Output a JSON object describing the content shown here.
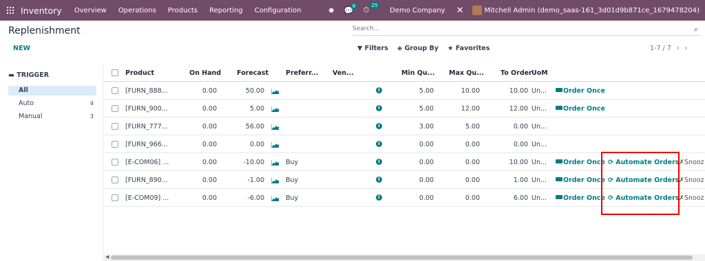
{
  "nav": {
    "brand": "Inventory",
    "menu": [
      "Overview",
      "Operations",
      "Products",
      "Reporting",
      "Configuration"
    ],
    "chat_badge": "6",
    "activity_badge": "25",
    "company": "Demo Company",
    "user": "Mitchell Admin (demo_saas-161_3d01d9b871ce_1679478204)"
  },
  "control": {
    "title": "Replenishment",
    "search_placeholder": "Search...",
    "new_label": "NEW",
    "filters_label": "Filters",
    "group_by_label": "Group By",
    "favorites_label": "Favorites",
    "pager": "1-7 / 7"
  },
  "sidebar": {
    "heading": "TRIGGER",
    "items": [
      {
        "label": "All",
        "count": ""
      },
      {
        "label": "Auto",
        "count": "4"
      },
      {
        "label": "Manual",
        "count": "3"
      }
    ]
  },
  "columns": [
    "Product",
    "On Hand",
    "Forecast",
    "Preferr...",
    "Ven...",
    "Min Qu...",
    "Max Qu...",
    "To Order",
    "UoM"
  ],
  "rows": [
    {
      "product": "[FURN_888...",
      "on_hand": "0.00",
      "forecast": "50.00",
      "route": "",
      "min": "5.00",
      "max": "10.00",
      "to_order": "10.00",
      "uom": "Un...",
      "order_once": "Order Once",
      "automate": "",
      "snooze": ""
    },
    {
      "product": "[FURN_900...",
      "on_hand": "0.00",
      "forecast": "5.00",
      "route": "",
      "min": "5.00",
      "max": "12.00",
      "to_order": "12.00",
      "uom": "Un...",
      "order_once": "Order Once",
      "automate": "",
      "snooze": ""
    },
    {
      "product": "[FURN_777...",
      "on_hand": "0.00",
      "forecast": "56.00",
      "route": "",
      "min": "3.00",
      "max": "5.00",
      "to_order": "0.00",
      "uom": "Un...",
      "order_once": "",
      "automate": "",
      "snooze": ""
    },
    {
      "product": "[FURN_966...",
      "on_hand": "0.00",
      "forecast": "0.00",
      "route": "",
      "min": "0.00",
      "max": "0.00",
      "to_order": "0.00",
      "uom": "Un...",
      "order_once": "",
      "automate": "",
      "snooze": ""
    },
    {
      "product": "[E-COM06] ...",
      "on_hand": "0.00",
      "forecast": "-10.00",
      "route": "Buy",
      "min": "0.00",
      "max": "0.00",
      "to_order": "10.00",
      "uom": "Un...",
      "order_once": "Order Once",
      "automate": "Automate Orders",
      "snooze": "Snooz"
    },
    {
      "product": "[FURN_890...",
      "on_hand": "0.00",
      "forecast": "-1.00",
      "route": "Buy",
      "min": "0.00",
      "max": "0.00",
      "to_order": "1.00",
      "uom": "Un...",
      "order_once": "Order Once",
      "automate": "Automate Orders",
      "snooze": "Snooz"
    },
    {
      "product": "[E-COM09] ...",
      "on_hand": "0.00",
      "forecast": "-6.00",
      "route": "Buy",
      "min": "0.00",
      "max": "0.00",
      "to_order": "6.00",
      "uom": "Un...",
      "order_once": "Order Once",
      "automate": "Automate Orders",
      "snooze": "Snooz"
    }
  ]
}
